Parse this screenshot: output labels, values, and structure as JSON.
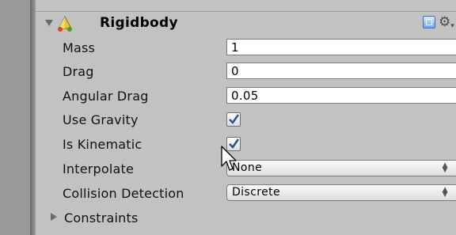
{
  "component": {
    "title": "Rigidbody",
    "expanded": true,
    "icon": "rigidbody-icon",
    "help_icon": "help-book-icon",
    "settings_icon": "gear-icon"
  },
  "fields": {
    "mass": {
      "label": "Mass",
      "value": "1"
    },
    "drag": {
      "label": "Drag",
      "value": "0"
    },
    "angular_drag": {
      "label": "Angular Drag",
      "value": "0.05"
    },
    "use_gravity": {
      "label": "Use Gravity",
      "checked": true
    },
    "is_kinematic": {
      "label": "Is Kinematic",
      "checked": true
    },
    "interpolate": {
      "label": "Interpolate",
      "selected": "None"
    },
    "collision_detection": {
      "label": "Collision Detection",
      "selected": "Discrete"
    },
    "constraints": {
      "label": "Constraints",
      "expanded": false
    }
  },
  "colors": {
    "panel_bg": "#c2c2c2",
    "field_bg": "#ffffff",
    "checkmark": "#2a4f8a"
  }
}
